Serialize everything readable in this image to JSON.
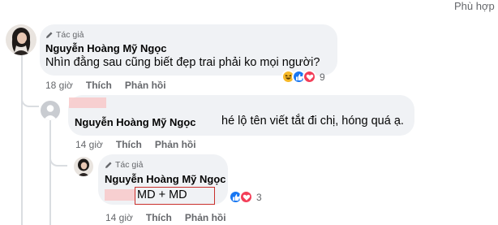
{
  "header": {
    "partial_link": "Phù hợp"
  },
  "comments": [
    {
      "author_badge": "Tác giả",
      "author": "Nguyễn Hoàng Mỹ Ngọc",
      "text": "Nhìn đằng sau cũng biết đẹp trai phải ko mọi người?",
      "time": "18 giờ",
      "like": "Thích",
      "reply": "Phản hồi",
      "reaction_count": "9"
    },
    {
      "author": "",
      "mention": "Nguyễn Hoàng Mỹ Ngọc",
      "text": "hé lộ tên viết tắt đi chị, hóng quá ạ.",
      "time": "14 giờ",
      "like": "Thích",
      "reply": "Phản hồi"
    },
    {
      "author_badge": "Tác giả",
      "author": "Nguyễn Hoàng Mỹ Ngọc",
      "text": "MD + MD",
      "time": "14 giờ",
      "like": "Thích",
      "reply": "Phản hồi",
      "reaction_count": "3"
    }
  ],
  "icons": {
    "haha": "haha-reaction-icon",
    "like": "like-reaction-icon",
    "love": "love-reaction-icon",
    "pencil": "pencil-icon"
  },
  "colors": {
    "like_blue": "#1877f2",
    "love_red": "#f33e58",
    "haha_yellow": "#f7b928",
    "meta_gray": "#65676b",
    "bubble_bg": "#f0f2f5",
    "highlight_red": "#c9302c"
  }
}
